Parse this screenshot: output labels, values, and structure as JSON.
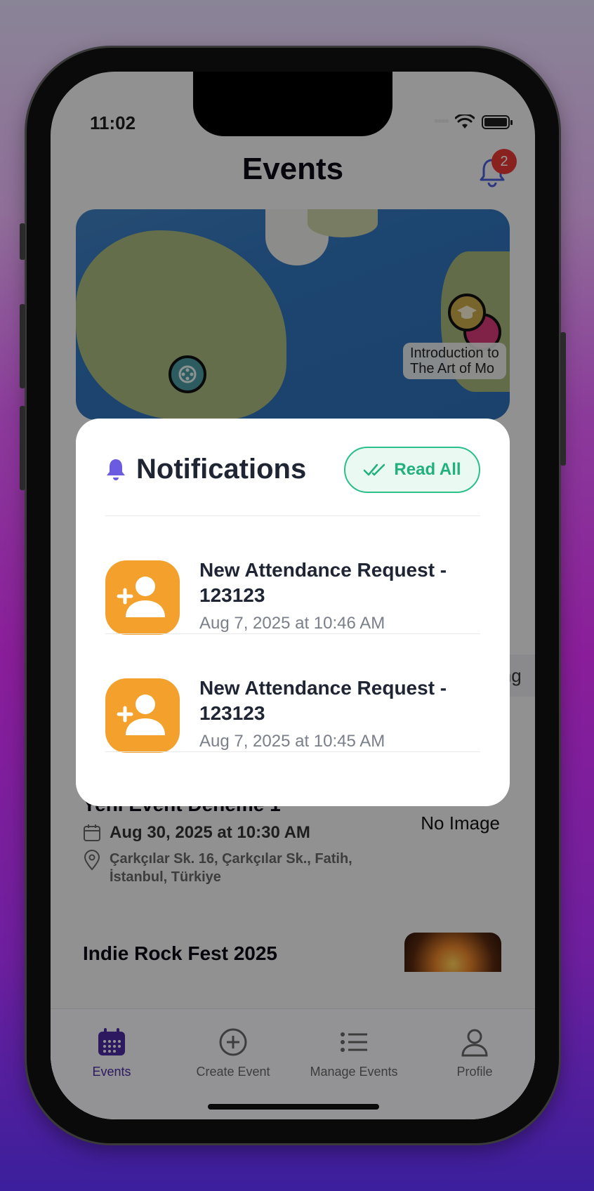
{
  "status": {
    "time": "11:02"
  },
  "header": {
    "title": "Events",
    "notification_count": "2"
  },
  "map": {
    "label_line1": "Introduction to",
    "label_line2": "The Art of Mo"
  },
  "partial_text": "ing",
  "events": [
    {
      "title": "Yeni Event Deneme 1",
      "date": "Aug 30, 2025 at 10:30 AM",
      "location": "Çarkçılar Sk. 16, Çarkçılar Sk., Fatih, İstanbul, Türkiye",
      "image_text": "No Image"
    },
    {
      "title": "Indie Rock Fest 2025"
    }
  ],
  "tabs": [
    {
      "label": "Events",
      "icon": "calendar-icon",
      "active": true
    },
    {
      "label": "Create Event",
      "icon": "plus-circle-icon",
      "active": false
    },
    {
      "label": "Manage Events",
      "icon": "list-icon",
      "active": false
    },
    {
      "label": "Profile",
      "icon": "person-icon",
      "active": false
    }
  ],
  "modal": {
    "title": "Notifications",
    "read_all_label": "Read All",
    "items": [
      {
        "title": "New Attendance Request - 123123",
        "time": "Aug 7, 2025 at 10:46 AM",
        "icon": "add-person-icon"
      },
      {
        "title": "New Attendance Request - 123123",
        "time": "Aug 7, 2025 at 10:45 AM",
        "icon": "add-person-icon"
      }
    ]
  },
  "colors": {
    "accent": "#4b2a9e",
    "success": "#22b07e",
    "avatar": "#f3a12c",
    "badge": "#e53935"
  }
}
